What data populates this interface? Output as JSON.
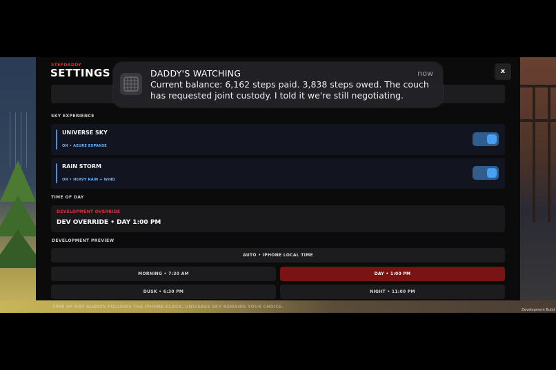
{
  "settings": {
    "brand": "STEPDADDY",
    "title": "SETTINGS",
    "close_label": "x"
  },
  "sky_experience": {
    "section_label": "SKY EXPERIENCE",
    "items": [
      {
        "name": "UNIVERSE SKY",
        "status": "ON • AZURE EXPANSE",
        "enabled": true
      },
      {
        "name": "RAIN STORM",
        "status": "ON • HEAVY RAIN + WIND",
        "enabled": true
      }
    ]
  },
  "time_of_day": {
    "section_label": "TIME OF DAY",
    "override_label": "DEVELOPMENT OVERRIDE",
    "override_value": "DEV OVERRIDE • DAY 1:00 PM"
  },
  "dev_preview": {
    "section_label": "DEVELOPMENT PREVIEW",
    "auto_label": "AUTO • IPHONE LOCAL TIME",
    "options": [
      {
        "label": "MORNING • 7:30 AM",
        "selected": false
      },
      {
        "label": "DAY • 1:00 PM",
        "selected": true
      },
      {
        "label": "DUSK • 6:30 PM",
        "selected": false
      },
      {
        "label": "NIGHT • 11:00 PM",
        "selected": false
      }
    ],
    "accent_color": "#7a1414"
  },
  "footer": {
    "text": "TIME OF DAY ALWAYS FOLLOWS THE IPHONE CLOCK. UNIVERSE SKY REMAINS YOUR CHOICE.",
    "dev_build": "Development Build"
  },
  "notification": {
    "title": "DADDY'S WATCHING",
    "time": "now",
    "body": "Current balance: 6,162 steps paid. 3,838 steps owed. The couch has requested joint custody. I told it we're still negotiating.",
    "icon": "app-grid-icon"
  }
}
